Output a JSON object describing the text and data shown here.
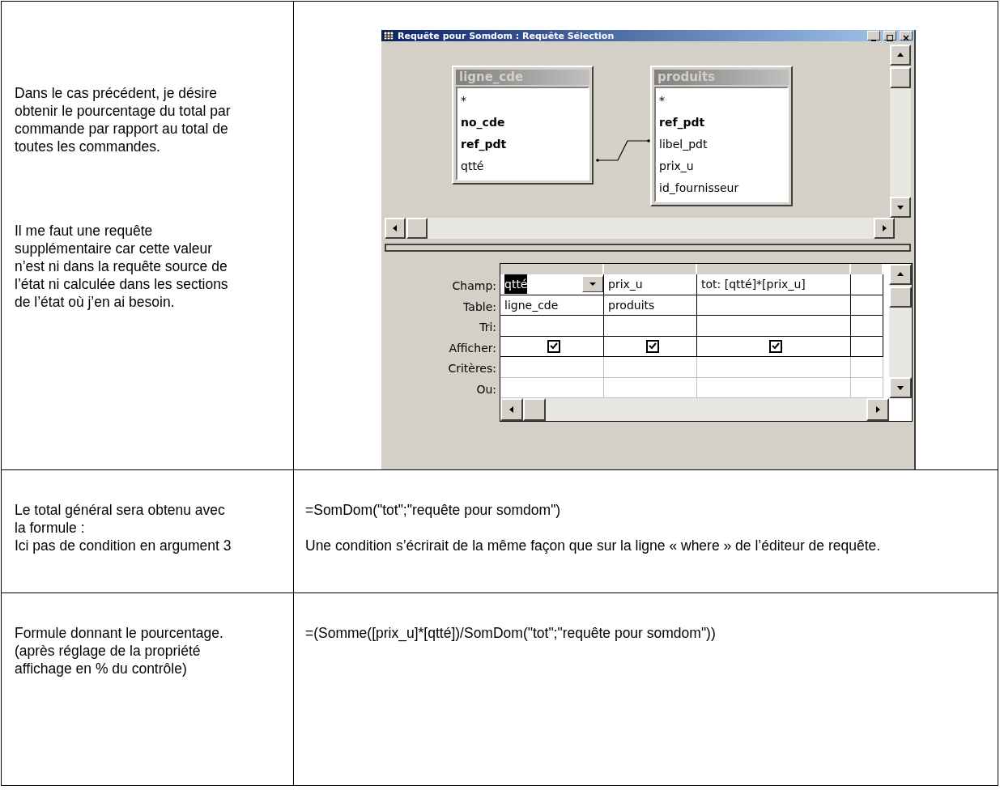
{
  "rows": [
    {
      "left": [
        "Dans le cas précédent, je désire obtenir le pourcentage du total par commande par rapport au total de toutes les commandes.",
        "Il me faut une requête supplémentaire car cette valeur n’est ni dans la requête source de l’état ni calculée dans les sections de l’état où j’en ai besoin."
      ],
      "kind": "window",
      "right": []
    },
    {
      "left": [
        "Le total général sera obtenu avec la formule :",
        "Ici pas de condition en argument 3"
      ],
      "kind": "text",
      "right": [
        "=SomDom(\"tot\";\"requête pour somdom\")",
        "Une condition s’écrirait de la même façon que sur la ligne « where » de l’éditeur de requête."
      ]
    },
    {
      "left": [
        "Formule donnant le pourcentage.",
        "(après réglage de la propriété affichage en % du contrôle)"
      ],
      "kind": "text",
      "right": [
        "=(Somme([prix_u]*[qtté])/SomDom(\"tot\";\"requête pour somdom\"))"
      ]
    }
  ],
  "window": {
    "title": "Requête pour Somdom : Requête Sélection",
    "tables": [
      {
        "name": "ligne_cde",
        "fields": [
          {
            "name": "*",
            "key": false
          },
          {
            "name": "no_cde",
            "key": true
          },
          {
            "name": "ref_pdt",
            "key": true
          },
          {
            "name": "qtté",
            "key": false
          }
        ]
      },
      {
        "name": "produits",
        "fields": [
          {
            "name": "*",
            "key": false
          },
          {
            "name": "ref_pdt",
            "key": true
          },
          {
            "name": "libel_pdt",
            "key": false
          },
          {
            "name": "prix_u",
            "key": false
          },
          {
            "name": "id_fournisseur",
            "key": false
          }
        ]
      }
    ],
    "row_labels": [
      "Champ:",
      "Table:",
      "Tri:",
      "Afficher:",
      "Critères:",
      "Ou:"
    ],
    "columns": [
      {
        "field": "qtté",
        "table": "ligne_cde",
        "selected": true,
        "checked": true
      },
      {
        "field": "prix_u",
        "table": "produits",
        "selected": false,
        "checked": true
      },
      {
        "field": "tot: [qtté]*[prix_u]",
        "selected": false,
        "checked": true
      }
    ]
  }
}
